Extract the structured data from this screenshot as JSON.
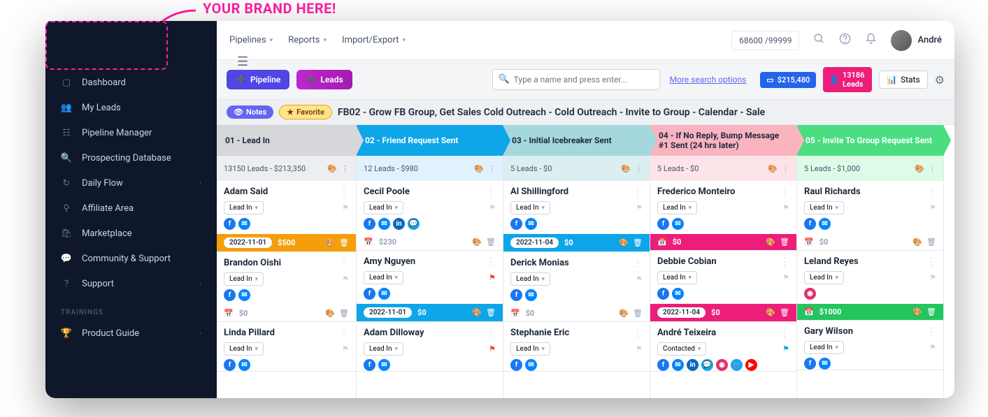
{
  "callout": "YOUR BRAND HERE!",
  "sidebar": {
    "items": [
      {
        "icon": "dashboard",
        "label": "Dashboard"
      },
      {
        "icon": "users",
        "label": "My Leads"
      },
      {
        "icon": "pipeline",
        "label": "Pipeline Manager"
      },
      {
        "icon": "database",
        "label": "Prospecting Database"
      },
      {
        "icon": "flow",
        "label": "Daily Flow",
        "expand": true
      },
      {
        "icon": "affiliate",
        "label": "Affiliate Area"
      },
      {
        "icon": "market",
        "label": "Marketplace"
      },
      {
        "icon": "community",
        "label": "Community & Support"
      },
      {
        "icon": "support",
        "label": "Support",
        "expand": true
      }
    ],
    "heading": "TRAININGS",
    "training": [
      {
        "icon": "trophy",
        "label": "Product Guide",
        "expand": true
      }
    ]
  },
  "topbar": {
    "menus": [
      "Pipelines",
      "Reports",
      "Import/Export"
    ],
    "counter": "68600 /99999",
    "user": "André"
  },
  "toolbar": {
    "pipeline_label": "Pipeline",
    "leads_label": "Leads",
    "search_placeholder": "Type a name and press enter...",
    "more": "More search options",
    "total": "$215,480",
    "lead_count": "13186 Leads",
    "stats": "Stats"
  },
  "filter": {
    "notes": "Notes",
    "favorite": "Favorite",
    "title": "FB02 - Grow FB Group, Get Sales Cold Outreach - Cold Outreach - Invite to Group - Calendar - Sale"
  },
  "columns": [
    {
      "title": "01 - Lead In",
      "sub": "13150 Leads - $213,350",
      "cards": [
        {
          "name": "Adam Said",
          "sel": "Lead In",
          "soc": [
            "fb",
            "ms"
          ],
          "foot": {
            "style": "yellow",
            "date": "2022-11-01",
            "amt": "$500"
          }
        },
        {
          "name": "Brandon Oishi",
          "sel": "Lead In",
          "soc": [
            "fb",
            "ms"
          ],
          "foot": {
            "style": "plain",
            "amt": "$0"
          }
        },
        {
          "name": "Linda Pillard",
          "sel": "Lead In",
          "soc": [
            "fb",
            "ms"
          ]
        }
      ]
    },
    {
      "title": "02 - Friend Request Sent",
      "sub": "12 Leads - $980",
      "cards": [
        {
          "name": "Cecil Poole",
          "sel": "Lead In",
          "soc": [
            "fb",
            "ms",
            "li",
            "ch"
          ],
          "foot": {
            "style": "plain",
            "amt": "$230"
          }
        },
        {
          "name": "Amy Nguyen",
          "sel": "Lead In",
          "flag": "red",
          "soc": [
            "fb",
            "ms"
          ],
          "foot": {
            "style": "blue",
            "date": "2022-11-01",
            "amt": "$0"
          }
        },
        {
          "name": "Adam Dilloway",
          "sel": "Lead In",
          "flag": "red",
          "soc": [
            "fb",
            "ms"
          ]
        }
      ]
    },
    {
      "title": "03 - Initial Icebreaker Sent",
      "sub": "5 Leads - $0",
      "cards": [
        {
          "name": "Al Shillingford",
          "sel": "Lead In",
          "soc": [
            "fb",
            "ms"
          ],
          "foot": {
            "style": "blue",
            "date": "2022-11-04",
            "amt": "$0"
          }
        },
        {
          "name": "Derick Monias",
          "sel": "Lead In",
          "soc": [
            "fb",
            "ms"
          ],
          "foot": {
            "style": "plain",
            "amt": "$0"
          }
        },
        {
          "name": "Stephanie Eric",
          "sel": "Lead In",
          "soc": [
            "fb",
            "ms"
          ]
        }
      ]
    },
    {
      "title": "04 - If No Reply, Bump Message #1 Sent (24 hrs later)",
      "sub": "5 Leads - $0",
      "cards": [
        {
          "name": "Frederico Monteiro",
          "sel": "Lead In",
          "soc": [
            "fb",
            "ms"
          ],
          "foot": {
            "style": "pink",
            "amt": "$0"
          }
        },
        {
          "name": "Debbie Cobian",
          "sel": "Lead In",
          "soc": [
            "fb",
            "ms"
          ],
          "foot": {
            "style": "pink",
            "date": "2022-11-04",
            "amt": "$0"
          }
        },
        {
          "name": "André Teixeira",
          "sel": "Contacted",
          "flag": "blue",
          "soc": [
            "fb",
            "ms",
            "li",
            "ch",
            "ig",
            "tw",
            "yt"
          ]
        }
      ]
    },
    {
      "title": "05 - Invite To Group Request Sent",
      "sub": "5 Leads - $1,000",
      "cards": [
        {
          "name": "Raul Richards",
          "sel": "Lead In",
          "soc": [
            "fb",
            "ms"
          ],
          "foot": {
            "style": "plain",
            "amt": "$0"
          }
        },
        {
          "name": "Leland Reyes",
          "sel": "Lead In",
          "soc": [
            "ig"
          ],
          "foot": {
            "style": "green",
            "amt": "$1000"
          }
        },
        {
          "name": "Gary Wilson",
          "sel": "Lead In",
          "soc": [
            "fb",
            "ms"
          ]
        }
      ]
    }
  ]
}
